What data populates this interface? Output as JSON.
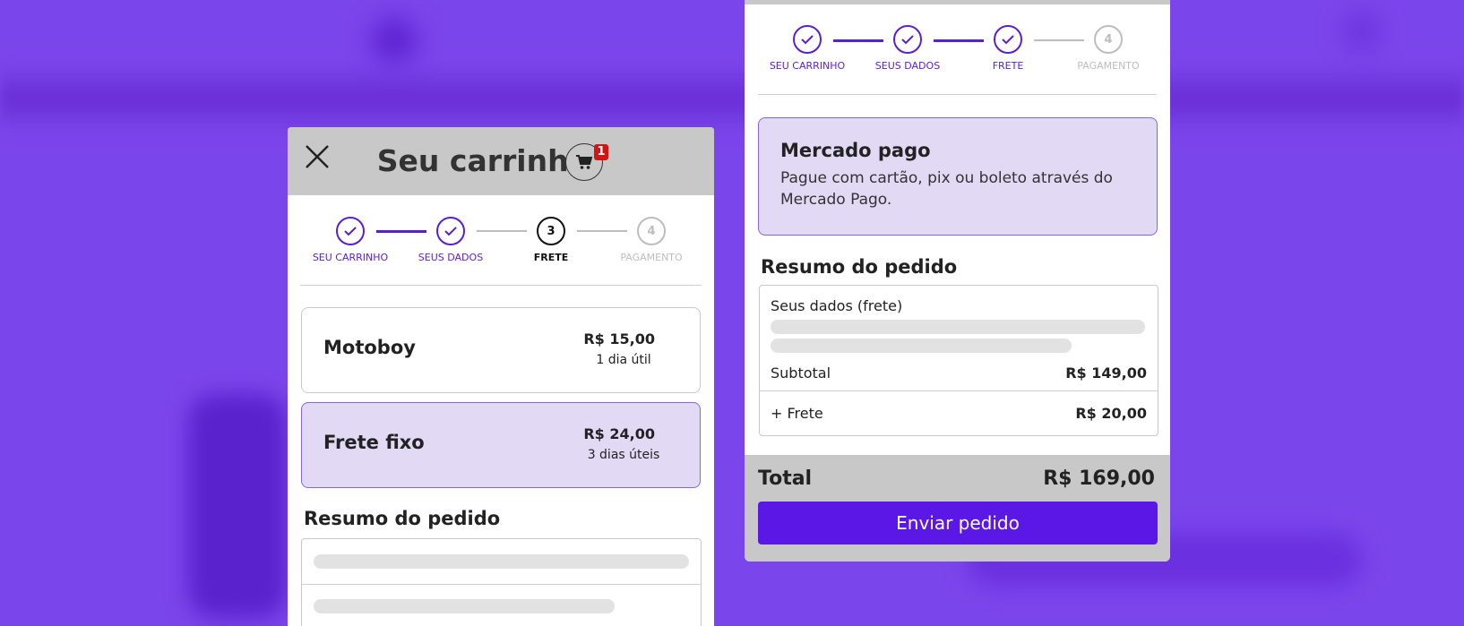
{
  "colors": {
    "background": "#7b45ec",
    "accent": "#5a1fd1",
    "selected_bg": "#e2d9f5",
    "badge": "#d51313",
    "button": "#5a17e6",
    "header_gray": "#c8c8c8"
  },
  "left_panel": {
    "title": "Seu carrinho",
    "cart_count": "1",
    "close_icon": "close-icon",
    "steps": [
      {
        "number": "1",
        "label": "SEU CARRINHO",
        "state": "done"
      },
      {
        "number": "2",
        "label": "SEUS DADOS",
        "state": "done"
      },
      {
        "number": "3",
        "label": "FRETE",
        "state": "active"
      },
      {
        "number": "4",
        "label": "PAGAMENTO",
        "state": "todo"
      }
    ],
    "shipping_options": [
      {
        "name": "Motoboy",
        "price": "R$ 15,00",
        "days": "1 dia útil",
        "selected": false
      },
      {
        "name": "Frete fixo",
        "price": "R$ 24,00",
        "days": "3 dias úteis",
        "selected": true
      }
    ],
    "summary_title": "Resumo do pedido"
  },
  "right_panel": {
    "steps": [
      {
        "number": "1",
        "label": "SEU CARRINHO",
        "state": "done"
      },
      {
        "number": "2",
        "label": "SEUS DADOS",
        "state": "done"
      },
      {
        "number": "3",
        "label": "FRETE",
        "state": "done"
      },
      {
        "number": "4",
        "label": "PAGAMENTO",
        "state": "todo"
      }
    ],
    "payment": {
      "title": "Mercado pago",
      "description": "Pague com cartão, pix ou boleto através do Mercado Pago."
    },
    "summary_title": "Resumo do pedido",
    "summary": {
      "data_label": "Seus dados (frete)",
      "subtotal_label": "Subtotal",
      "subtotal_value": "R$ 149,00",
      "shipping_label": "+ Frete",
      "shipping_value": "R$ 20,00"
    },
    "total_label": "Total",
    "total_value": "R$ 169,00",
    "send_button": "Enviar pedido"
  }
}
